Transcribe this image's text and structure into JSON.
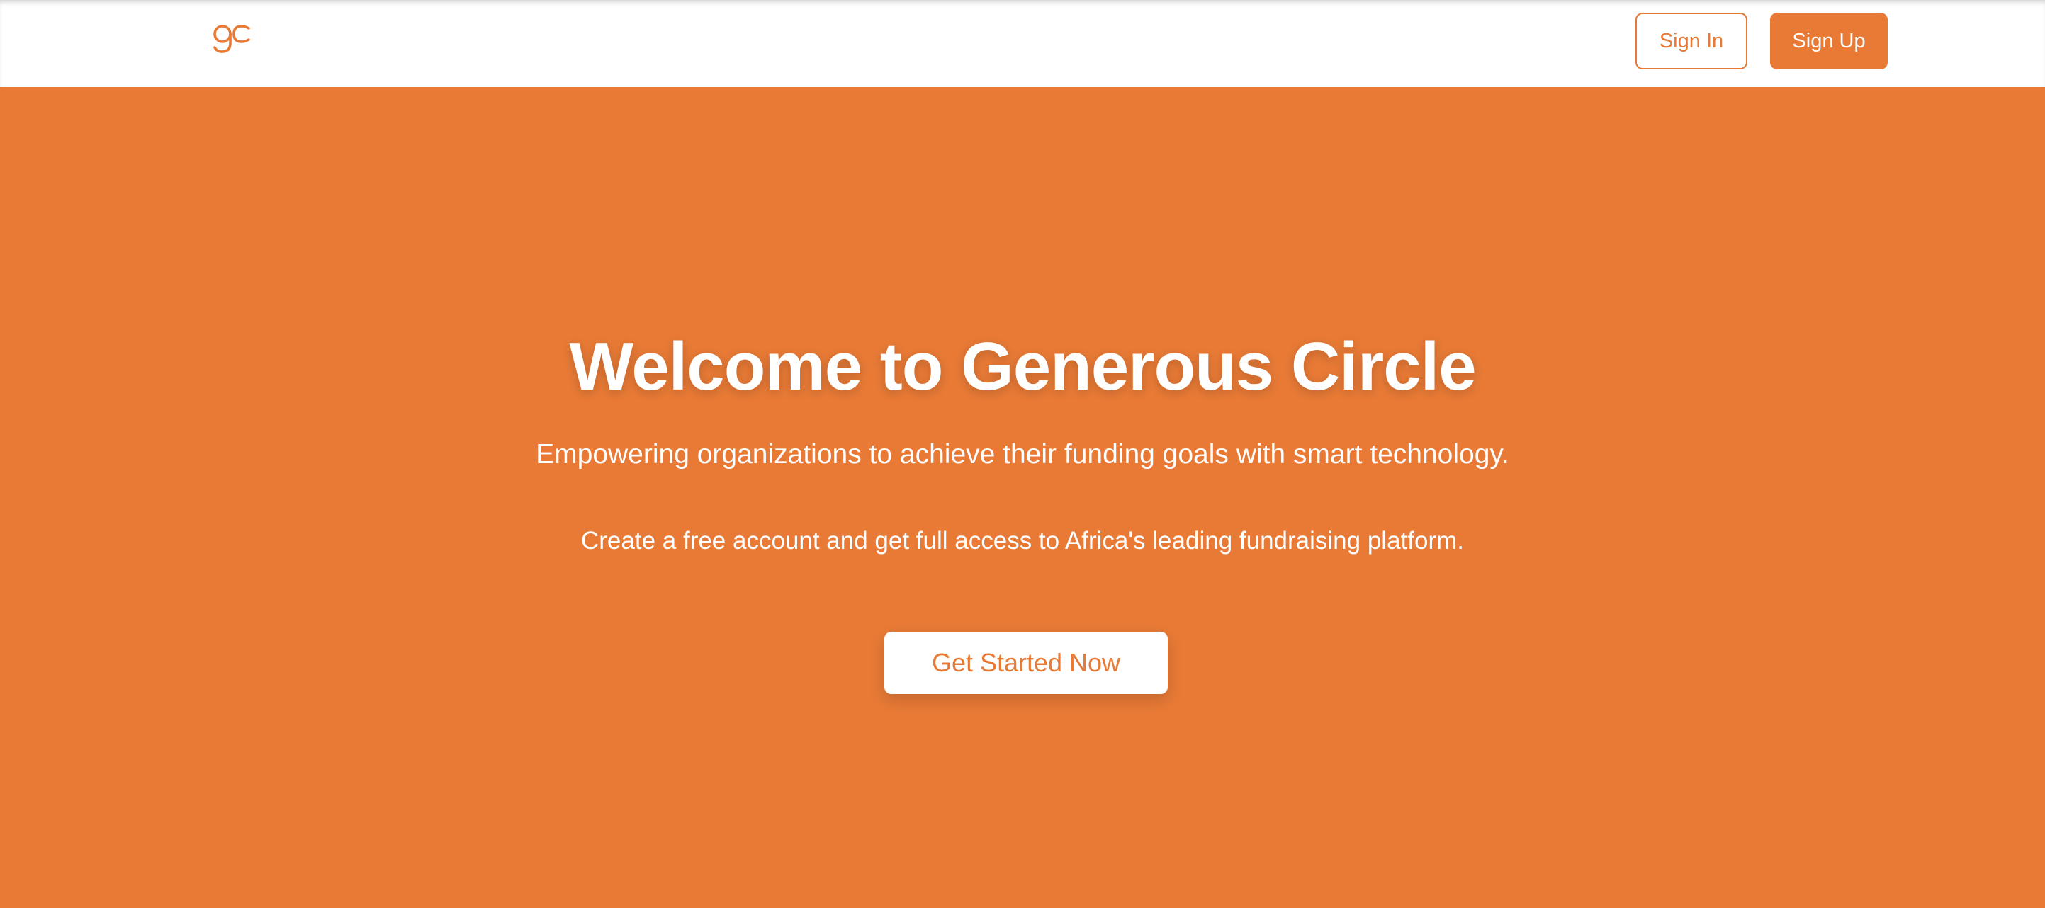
{
  "brand": {
    "logo_icon": "gc-logo-icon",
    "accent_color": "#e87a36"
  },
  "header": {
    "sign_in_label": "Sign In",
    "sign_up_label": "Sign Up"
  },
  "hero": {
    "title": "Welcome to Generous Circle",
    "subtitle": "Empowering organizations to achieve their funding goals with smart technology.",
    "description": "Create a free account and get full access to Africa's leading fundraising platform.",
    "cta_label": "Get Started Now",
    "background_color": "#e87a36"
  }
}
